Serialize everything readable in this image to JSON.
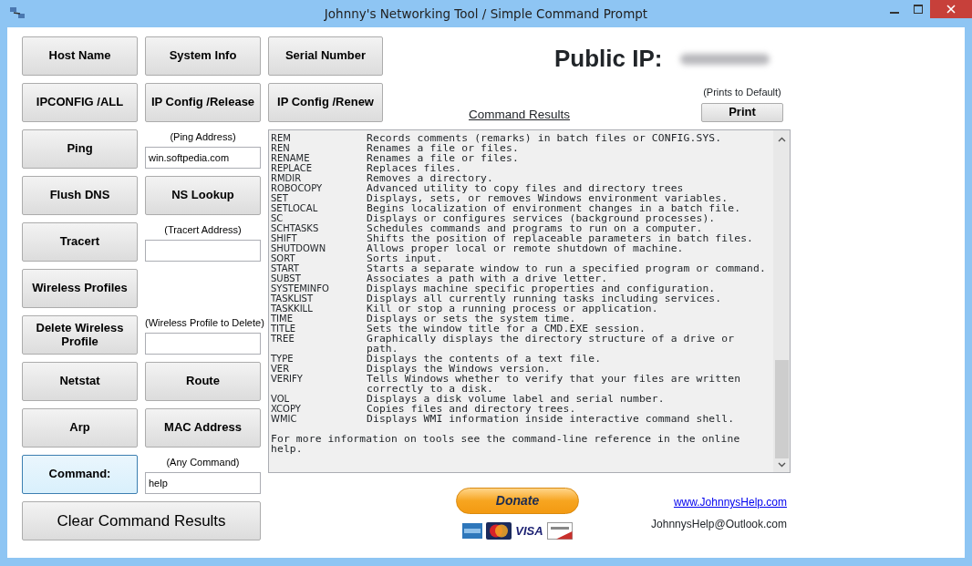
{
  "window": {
    "title": "Johnny's Networking Tool / Simple Command Prompt"
  },
  "left_rows": [
    [
      {
        "kind": "button",
        "label": "Host Name"
      },
      {
        "kind": "button",
        "label": "System Info"
      },
      {
        "kind": "button",
        "label": "Serial Number"
      }
    ],
    [
      {
        "kind": "button",
        "label": "IPCONFIG /ALL"
      },
      {
        "kind": "button",
        "label": "IP Config /Release"
      },
      {
        "kind": "button",
        "label": "IP Config /Renew"
      }
    ],
    [
      {
        "kind": "button",
        "label": "Ping"
      },
      {
        "kind": "field",
        "caption": "(Ping Address)",
        "value": "win.softpedia.com"
      }
    ],
    [
      {
        "kind": "button",
        "label": "Flush DNS"
      },
      {
        "kind": "button",
        "label": "NS Lookup"
      }
    ],
    [
      {
        "kind": "button",
        "label": "Tracert"
      },
      {
        "kind": "field",
        "caption": "(Tracert Address)"
      }
    ],
    [
      {
        "kind": "button",
        "label": "Wireless Profiles"
      }
    ],
    [
      {
        "kind": "button",
        "label": "Delete Wireless Profile"
      },
      {
        "kind": "field",
        "caption": "(Wireless Profile to Delete)"
      }
    ],
    [
      {
        "kind": "button",
        "label": "Netstat"
      },
      {
        "kind": "button",
        "label": "Route"
      }
    ],
    [
      {
        "kind": "button",
        "label": "Arp"
      },
      {
        "kind": "button",
        "label": "MAC Address"
      }
    ],
    [
      {
        "kind": "button",
        "label": "Command:",
        "focused": true
      },
      {
        "kind": "field",
        "caption": "(Any Command)",
        "value": "help"
      }
    ]
  ],
  "public_ip": {
    "label": "Public IP:",
    "value_blurred": true
  },
  "results_title": "Command Results",
  "print": {
    "note": "(Prints to Default)",
    "label": "Print"
  },
  "results": [
    {
      "command": "REM",
      "description": [
        "Records comments (remarks) in batch files or CONFIG.SYS."
      ]
    },
    {
      "command": "REN",
      "description": [
        "Renames a file or files."
      ]
    },
    {
      "command": "RENAME",
      "description": [
        "Renames a file or files."
      ]
    },
    {
      "command": "REPLACE",
      "description": [
        "Replaces files."
      ]
    },
    {
      "command": "RMDIR",
      "description": [
        "Removes a directory."
      ]
    },
    {
      "command": "ROBOCOPY",
      "description": [
        "Advanced utility to copy files and directory trees"
      ]
    },
    {
      "command": "SET",
      "description": [
        "Displays, sets, or removes Windows environment variables."
      ]
    },
    {
      "command": "SETLOCAL",
      "description": [
        "Begins localization of environment changes in a batch file."
      ]
    },
    {
      "command": "SC",
      "description": [
        "Displays or configures services (background processes)."
      ]
    },
    {
      "command": "SCHTASKS",
      "description": [
        "Schedules commands and programs to run on a computer."
      ]
    },
    {
      "command": "SHIFT",
      "description": [
        "Shifts the position of replaceable parameters in batch files."
      ]
    },
    {
      "command": "SHUTDOWN",
      "description": [
        "Allows proper local or remote shutdown of machine."
      ]
    },
    {
      "command": "SORT",
      "description": [
        "Sorts input."
      ]
    },
    {
      "command": "START",
      "description": [
        "Starts a separate window to run a specified program or command."
      ]
    },
    {
      "command": "SUBST",
      "description": [
        "Associates a path with a drive letter."
      ]
    },
    {
      "command": "SYSTEMINFO",
      "description": [
        "Displays machine specific properties and configuration."
      ]
    },
    {
      "command": "TASKLIST",
      "description": [
        "Displays all currently running tasks including services."
      ]
    },
    {
      "command": "TASKKILL",
      "description": [
        "Kill or stop a running process or application."
      ]
    },
    {
      "command": "TIME",
      "description": [
        "Displays or sets the system time."
      ]
    },
    {
      "command": "TITLE",
      "description": [
        "Sets the window title for a CMD.EXE session."
      ]
    },
    {
      "command": "TREE",
      "description": [
        "Graphically displays the directory structure of a drive or",
        "path."
      ]
    },
    {
      "command": "TYPE",
      "description": [
        "Displays the contents of a text file."
      ]
    },
    {
      "command": "VER",
      "description": [
        "Displays the Windows version."
      ]
    },
    {
      "command": "VERIFY",
      "description": [
        "Tells Windows whether to verify that your files are written",
        "correctly to a disk."
      ]
    },
    {
      "command": "VOL",
      "description": [
        "Displays a disk volume label and serial number."
      ]
    },
    {
      "command": "XCOPY",
      "description": [
        "Copies files and directory trees."
      ]
    },
    {
      "command": "WMIC",
      "description": [
        "Displays WMI information inside interactive command shell."
      ]
    }
  ],
  "results_footer": [
    "For more information on tools see the command-line reference in the online",
    "help."
  ],
  "clear_button": "Clear Command Results",
  "donate": "Donate",
  "cards": [
    {
      "kind": "amex"
    },
    {
      "kind": "mastercard"
    },
    {
      "kind": "visa",
      "label": "VISA"
    },
    {
      "kind": "discover"
    }
  ],
  "website": "www.JohnnysHelp.com",
  "email": "JohnnysHelp@Outlook.com"
}
